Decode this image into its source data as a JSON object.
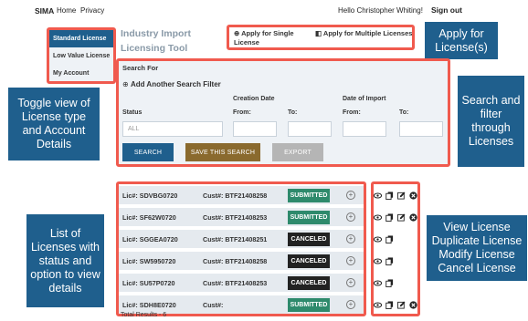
{
  "nav": {
    "brand": "SIMA",
    "home": "Home",
    "privacy": "Privacy",
    "greeting": "Hello Christopher Whiting!",
    "signout": "Sign out"
  },
  "sidebar": {
    "items": [
      {
        "label": "Standard License"
      },
      {
        "label": "Low Value License"
      },
      {
        "label": "My Account"
      }
    ]
  },
  "tool": {
    "title_line1": "Industry Import",
    "title_line2": "Licensing Tool"
  },
  "apply": {
    "single_line1": "Apply for Single",
    "single_line2": "License",
    "multiple": "Apply for Multiple Licenses"
  },
  "search": {
    "heading": "Search For",
    "add_filter": "Add Another Search Filter",
    "status_label": "Status",
    "status_value": "ALL",
    "creation_date_label": "Creation Date",
    "date_import_label": "Date of Import",
    "from_label": "From:",
    "to_label": "To:",
    "search_btn": "SEARCH",
    "save_btn": "SAVE THIS SEARCH",
    "export_btn": "EXPORT"
  },
  "results": {
    "rows": [
      {
        "lic": "Lic#: SDVBG0720",
        "cust": "Cust#: BTF21408258",
        "status": "SUBMITTED"
      },
      {
        "lic": "Lic#: SF62W0720",
        "cust": "Cust#: BTF21408253",
        "status": "SUBMITTED"
      },
      {
        "lic": "Lic#: SGGEA0720",
        "cust": "Cust#: BTF21408251",
        "status": "CANCELED"
      },
      {
        "lic": "Lic#: SW5950720",
        "cust": "Cust#: BTF21408258",
        "status": "CANCELED"
      },
      {
        "lic": "Lic#: SU57P0720",
        "cust": "Cust#: BTF21408253",
        "status": "CANCELED"
      },
      {
        "lic": "Lic#: SDH8E0720",
        "cust": "Cust#:",
        "status": "SUBMITTED"
      }
    ],
    "total": "Total Results - 6"
  },
  "callouts": {
    "apply": "Apply for License(s)",
    "toggle": "Toggle view of License type and Account Details",
    "search": "Search and filter through Licenses",
    "list": "List of Licenses with status and option to view details",
    "actions": "View License Duplicate License Modify License Cancel License"
  },
  "colors": {
    "primary": "#1f5f8d",
    "highlight": "#f05a4e",
    "save": "#8a6a2e",
    "export": "#b5b5b5",
    "submitted": "#2e8a6c",
    "canceled": "#222222"
  }
}
